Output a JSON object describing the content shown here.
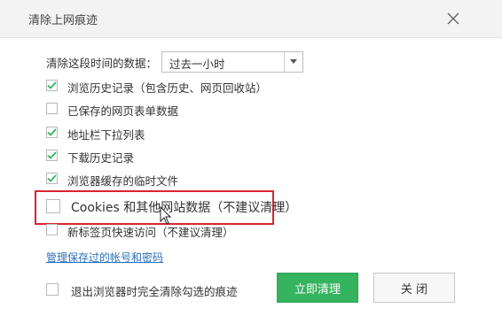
{
  "window": {
    "title": "清除上网痕迹"
  },
  "range": {
    "label": "清除这段时间的数据：",
    "value": "过去一小时"
  },
  "options": [
    {
      "label": "浏览历史记录（包含历史、网页回收站）",
      "checked": true
    },
    {
      "label": "已保存的网页表单数据",
      "checked": false
    },
    {
      "label": "地址栏下拉列表",
      "checked": true
    },
    {
      "label": "下载历史记录",
      "checked": true
    },
    {
      "label": "浏览器缓存的临时文件",
      "checked": true
    },
    {
      "label": "Cookies 和其他网站数据（不建议清理）",
      "checked": false
    },
    {
      "label": "新标签页快速访问（不建议清理）",
      "checked": false
    }
  ],
  "manage_link": "管理保存过的帐号和密码",
  "footer": {
    "exit_clear_label": "退出浏览器时完全清除勾选的痕迹",
    "exit_clear_checked": false,
    "clear_button": "立即清理",
    "close_button": "关 闭"
  },
  "colors": {
    "accent_green": "#35b35f",
    "highlight_red": "#d7262c",
    "link_blue": "#2b6fbd"
  },
  "icons": {
    "close": "close-icon",
    "dropdown": "chevron-down-icon",
    "check": "check-icon",
    "pointer": "mouse-pointer-icon"
  }
}
